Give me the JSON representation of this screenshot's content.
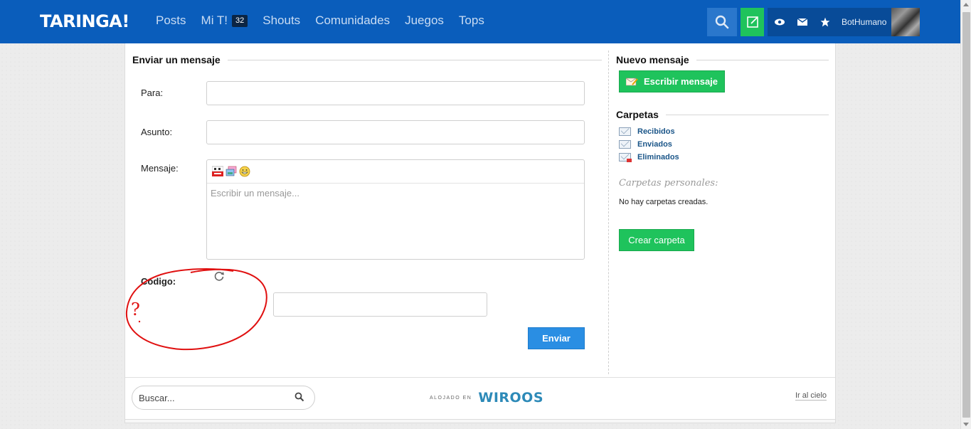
{
  "header": {
    "logo": "TARINGA!",
    "nav": [
      {
        "label": "Posts"
      },
      {
        "label": "Mi T!",
        "badge": "32"
      },
      {
        "label": "Shouts"
      },
      {
        "label": "Comunidades"
      },
      {
        "label": "Juegos"
      },
      {
        "label": "Tops"
      }
    ],
    "username": "BotHumano"
  },
  "compose": {
    "title": "Enviar un mensaje",
    "to_label": "Para:",
    "to_value": "",
    "subject_label": "Asunto:",
    "subject_value": "",
    "message_label": "Mensaje:",
    "message_placeholder": "Escribir un mensaje...",
    "captcha_label": "Código:",
    "captcha_value": "",
    "send_label": "Enviar"
  },
  "sidebar": {
    "new_title": "Nuevo mensaje",
    "write_label": "Escribir mensaje",
    "folders_title": "Carpetas",
    "folders": [
      {
        "label": "Recibidos"
      },
      {
        "label": "Enviados"
      },
      {
        "label": "Eliminados"
      }
    ],
    "personal_title": "Carpetas personales:",
    "no_folders": "No hay carpetas creadas.",
    "create_label": "Crear carpeta"
  },
  "footer": {
    "search_placeholder": "Buscar...",
    "hosted_small": "ALOJADO EN",
    "hosted_brand": "WIROOS",
    "top_link": "Ir al cielo"
  },
  "annotation": {
    "mark": "?",
    "color": "#e01010"
  },
  "colors": {
    "header": "#0a5dbb",
    "green": "#1fc35c",
    "send": "#2a8ee3"
  }
}
